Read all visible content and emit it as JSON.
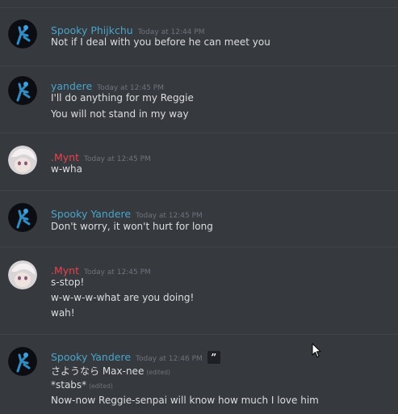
{
  "colors": {
    "background": "#36393e",
    "divider": "#40434a",
    "spooky_name": "#4aa4c7",
    "mynt_name": "#e8424f",
    "text": "#dcddde",
    "timestamp": "#6f737b"
  },
  "messages": [
    {
      "author": "Spooky Phijkchu",
      "avatar": "spooky-avatar",
      "timestamp": "Today at 12:44 PM",
      "lines": [
        "Not if I deal with you before he can meet you"
      ]
    },
    {
      "author": "yandere",
      "avatar": "spooky-avatar",
      "timestamp": "Today at 12:45 PM",
      "lines": [
        "I'll do anything for my Reggie",
        "You will not stand in my way"
      ]
    },
    {
      "author": ".Mynt",
      "avatar": "mynt-avatar",
      "timestamp": "Today at 12:45 PM",
      "lines": [
        "w-wha"
      ]
    },
    {
      "author": "Spooky Yandere",
      "avatar": "spooky-avatar",
      "timestamp": "Today at 12:45 PM",
      "lines": [
        "Don't worry, it won't hurt for long"
      ]
    },
    {
      "author": ".Mynt",
      "avatar": "mynt-avatar",
      "timestamp": "Today at 12:45 PM",
      "lines": [
        "s-stop!",
        "w-w-w-w-what are you doing!",
        "wah!"
      ]
    },
    {
      "author": "Spooky Yandere",
      "avatar": "spooky-avatar",
      "timestamp": "Today at 12:46 PM",
      "quote_icon": "quote-icon",
      "lines": [
        "さようなら Max-nee",
        "*stabs*",
        "Now-now Reggie-senpai will know how much I love him"
      ],
      "edited_label": "(edited)"
    }
  ],
  "cursor_icon": "mouse-pointer-icon"
}
